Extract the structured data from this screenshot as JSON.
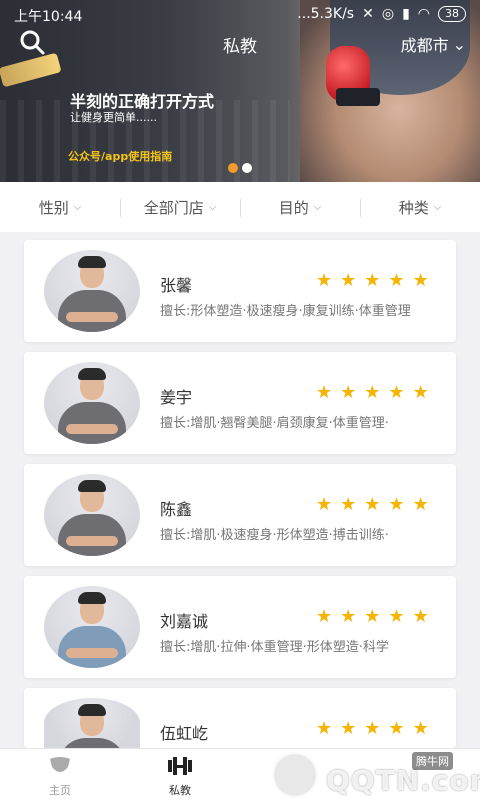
{
  "status_bar": {
    "time": "上午10:44",
    "network_speed": "...5.3K/s",
    "battery": "38"
  },
  "header": {
    "title": "私教",
    "city": "成都市"
  },
  "banner": {
    "headline": "半刻的正确打开方式",
    "subtitle": "让健身更简单......",
    "guide": "公众号/app使用指南",
    "carousel_count": 2,
    "carousel_active_index": 0
  },
  "filters": [
    {
      "label": "性别"
    },
    {
      "label": "全部门店"
    },
    {
      "label": "目的"
    },
    {
      "label": "种类"
    }
  ],
  "trainers": [
    {
      "name": "张馨",
      "rating": 5,
      "skills": "擅长:形体塑造·极速瘦身·康复训练·体重管理"
    },
    {
      "name": "姜宇",
      "rating": 5,
      "skills": "擅长:增肌·翘臀美腿·肩颈康复·体重管理·"
    },
    {
      "name": "陈鑫",
      "rating": 5,
      "skills": "擅长:增肌·极速瘦身·形体塑造·搏击训练·"
    },
    {
      "name": "刘嘉诚",
      "rating": 5,
      "skills": "擅长:增肌·拉伸·体重管理·形体塑造·科学"
    },
    {
      "name": "伍虹屹",
      "rating": 5,
      "skills": ""
    }
  ],
  "bottom_nav": [
    {
      "label": "主页",
      "icon": "muscle-icon",
      "active": false
    },
    {
      "label": "私教",
      "icon": "dumbbell-icon",
      "active": true
    }
  ],
  "watermark": {
    "brand": "QQTN.com",
    "site": "腾牛网"
  },
  "colors": {
    "accent": "#f39a2b",
    "star": "#f4b400",
    "guide": "#f5c518"
  }
}
